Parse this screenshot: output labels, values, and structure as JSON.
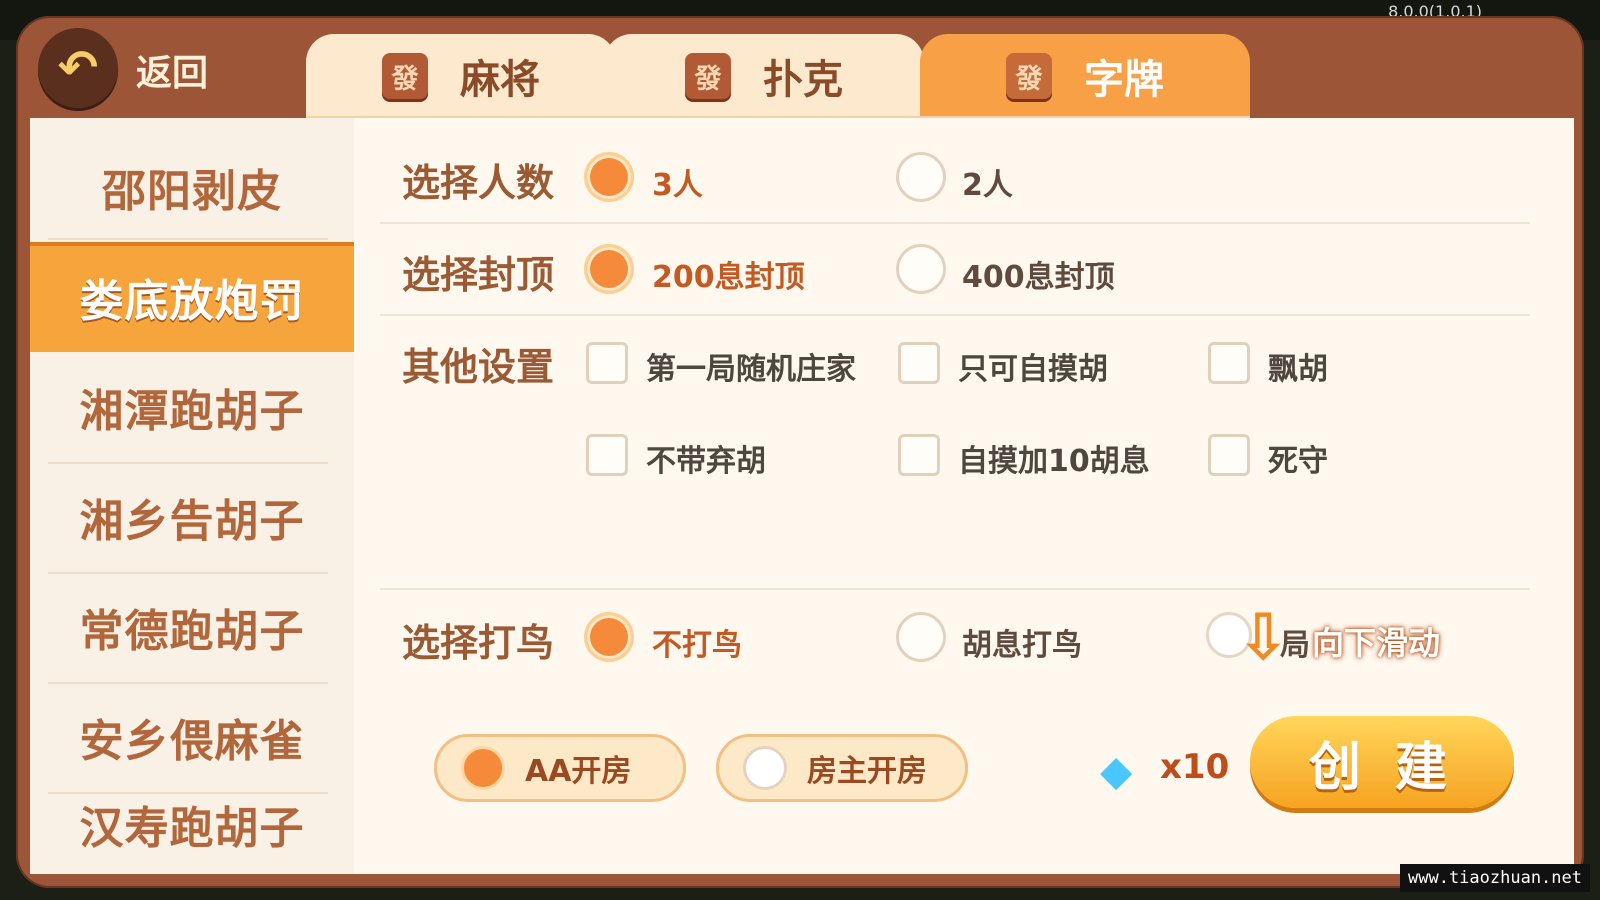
{
  "app": {
    "version": "8.0.0(1.0.1)"
  },
  "header": {
    "back_label": "返回",
    "tabs": [
      {
        "label": "麻将",
        "tile": "發",
        "active": false
      },
      {
        "label": "扑克",
        "tile": "發",
        "active": false
      },
      {
        "label": "字牌",
        "tile": "發",
        "active": true
      }
    ]
  },
  "sidebar": {
    "items": [
      {
        "label": "邵阳剥皮",
        "active": false
      },
      {
        "label": "娄底放炮罚",
        "active": true
      },
      {
        "label": "湘潭跑胡子",
        "active": false
      },
      {
        "label": "湘乡告胡子",
        "active": false
      },
      {
        "label": "常德跑胡子",
        "active": false
      },
      {
        "label": "安乡偎麻雀",
        "active": false
      },
      {
        "label": "汉寿跑胡子",
        "active": false
      }
    ]
  },
  "settings": {
    "players": {
      "label": "选择人数",
      "options": [
        "3人",
        "2人"
      ],
      "selected": "3人"
    },
    "cap": {
      "label": "选择封顶",
      "options": [
        "200息封顶",
        "400息封顶"
      ],
      "selected": "200息封顶"
    },
    "other": {
      "label": "其他设置",
      "options": [
        "第一局随机庄家",
        "只可自摸胡",
        "飘胡",
        "不带弃胡",
        "自摸加10胡息",
        "死守"
      ]
    },
    "birds": {
      "label": "选择打鸟",
      "options": [
        "不打鸟",
        "胡息打鸟",
        "局"
      ],
      "selected": "不打鸟"
    }
  },
  "footer": {
    "room_modes": [
      "AA开房",
      "房主开房"
    ],
    "selected_mode": "AA开房",
    "diamond_cost": "x10",
    "create_label": "创 建",
    "scroll_hint": "向下滑动"
  },
  "icons": {
    "back": "back-arrow-icon",
    "tile": "mahjong-tile-icon",
    "diamond": "diamond-icon",
    "scroll": "down-arrow-icon"
  },
  "colors": {
    "accent": "#f58a3a",
    "active_tab": "#f7a045",
    "frame": "#9c5637",
    "create_button": "#f7a321"
  },
  "watermark": "www.tiaozhuan.net"
}
